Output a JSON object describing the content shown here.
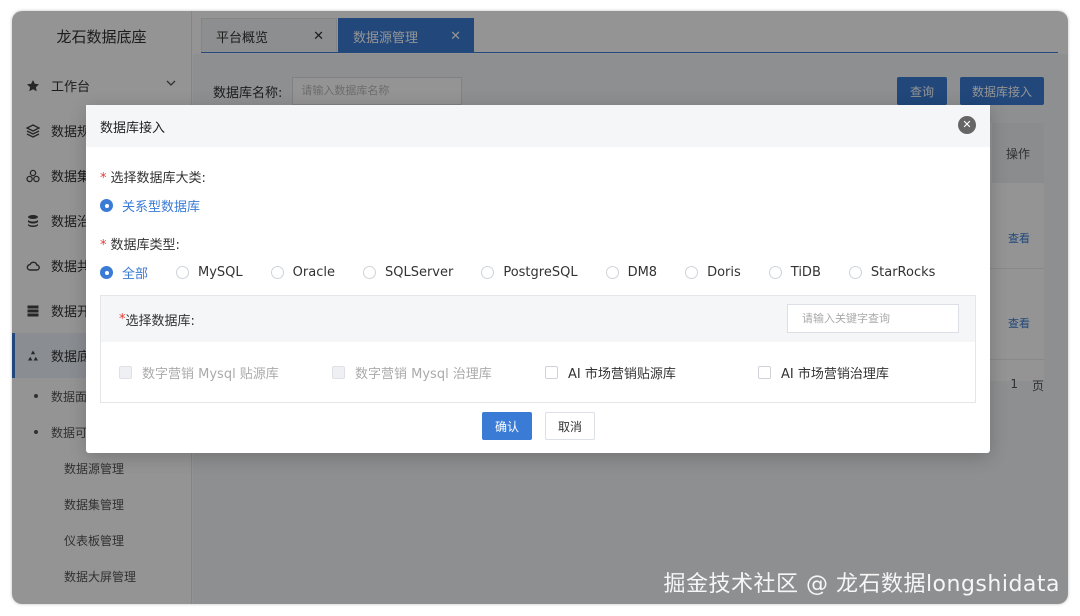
{
  "sidebar": {
    "brand": "龙石数据底座",
    "items": [
      {
        "label": "工作台",
        "icon": "star-icon"
      },
      {
        "label": "数据规",
        "icon": "layers-icon"
      },
      {
        "label": "数据集",
        "icon": "cluster-icon"
      },
      {
        "label": "数据治",
        "icon": "database-icon"
      },
      {
        "label": "数据共",
        "icon": "cloud-icon"
      },
      {
        "label": "数据开",
        "icon": "stack-icon"
      },
      {
        "label": "数据底",
        "icon": "recycle-icon"
      }
    ],
    "sub_items": [
      {
        "label": "数据面"
      },
      {
        "label": "数据可"
      }
    ],
    "leaf_items": [
      {
        "label": "数据源管理"
      },
      {
        "label": "数据集管理"
      },
      {
        "label": "仪表板管理"
      },
      {
        "label": "数据大屏管理"
      }
    ]
  },
  "tabs": [
    {
      "label": "平台概览",
      "close": "✕"
    },
    {
      "label": "数据源管理",
      "close": "✕"
    }
  ],
  "search": {
    "label": "数据库名称:",
    "placeholder": "请输入数据库名称",
    "query_button": "查询",
    "access_button": "数据库接入"
  },
  "table": {
    "action_header": "操作",
    "row_action": "查看"
  },
  "pager": {
    "page": "1",
    "unit": "页"
  },
  "dialog": {
    "title": "数据库接入",
    "close_icon": "✕",
    "category_label": "选择数据库大类:",
    "category_options": [
      "关系型数据库"
    ],
    "type_label": "数据库类型:",
    "type_options": [
      "全部",
      "MySQL",
      "Oracle",
      "SQLServer",
      "PostgreSQL",
      "DM8",
      "Doris",
      "TiDB",
      "StarRocks"
    ],
    "select_db_label": "选择数据库:",
    "keyword_placeholder": "请输入关键字查询",
    "db_options": [
      {
        "label": "数字营销 Mysql 贴源库",
        "disabled": true
      },
      {
        "label": "数字营销 Mysql 治理库",
        "disabled": true
      },
      {
        "label": "AI 市场营销贴源库",
        "disabled": false
      },
      {
        "label": "AI 市场营销治理库",
        "disabled": false
      }
    ],
    "confirm": "确认",
    "cancel": "取消"
  },
  "watermark": "掘金技术社区 @ 龙石数据longshidata",
  "colors": {
    "primary": "#3a7bd5",
    "required": "#e53935"
  }
}
